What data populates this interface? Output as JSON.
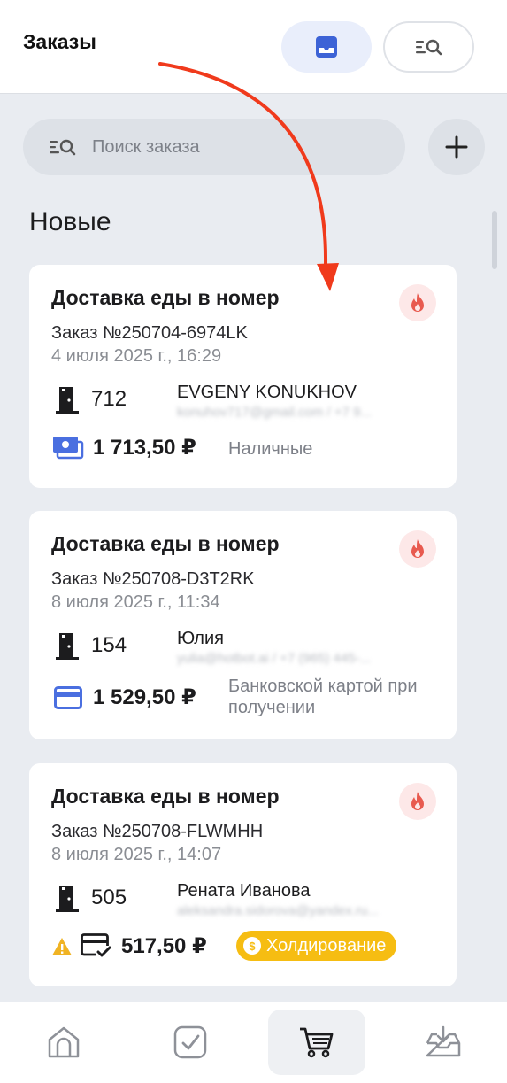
{
  "header": {
    "title": "Заказы",
    "view_toggle": {
      "active": "inbox-icon",
      "inactive": "list-search-icon"
    }
  },
  "search": {
    "placeholder": "Поиск заказа",
    "value": "",
    "add_icon": "plus-icon"
  },
  "section": {
    "title": "Новые"
  },
  "orders": [
    {
      "title": "Доставка еды в номер",
      "number": "Заказ №250704-6974LK",
      "date": "4 июля 2025 г., 16:29",
      "urgent_icon": "fire-icon",
      "room": "712",
      "guest_name": "EVGENY KONUKHOV",
      "guest_contact": "konuhov717@gmail.com / +7 9...",
      "amount": "1 713,50 ₽",
      "payment_icon": "cash-icon",
      "payment_method": "Наличные"
    },
    {
      "title": "Доставка еды в номер",
      "number": "Заказ №250708-D3T2RK",
      "date": "8 июля 2025 г., 11:34",
      "urgent_icon": "fire-icon",
      "room": "154",
      "guest_name": "Юлия",
      "guest_contact": "yulia@hotbot.ai / +7 (965) 445-...",
      "amount": "1 529,50 ₽",
      "payment_icon": "credit-card-icon",
      "payment_method": "Банковской картой при получении"
    },
    {
      "title": "Доставка еды в номер",
      "number": "Заказ №250708-FLWMHH",
      "date": "8 июля 2025 г., 14:07",
      "urgent_icon": "fire-icon",
      "room": "505",
      "guest_name": "Рената Иванова",
      "guest_contact": "aleksandra.sidorova@yandex.ru...",
      "amount": "517,50 ₽",
      "warning_icon": "warning-icon",
      "payment_icon": "card-check-icon",
      "status_badge": "Холдирование"
    }
  ],
  "bottom_nav": [
    {
      "icon": "home-icon",
      "active": false
    },
    {
      "icon": "checkbox-icon",
      "active": false
    },
    {
      "icon": "cart-icon",
      "active": true
    },
    {
      "icon": "inbox-download-icon",
      "active": false
    }
  ],
  "colors": {
    "accent_blue": "#4a6fe0",
    "fire_red": "#e85a4f",
    "hold_yellow": "#f6bd12",
    "annotation_arrow": "#f03a1c",
    "background": "#e9ecf1"
  }
}
